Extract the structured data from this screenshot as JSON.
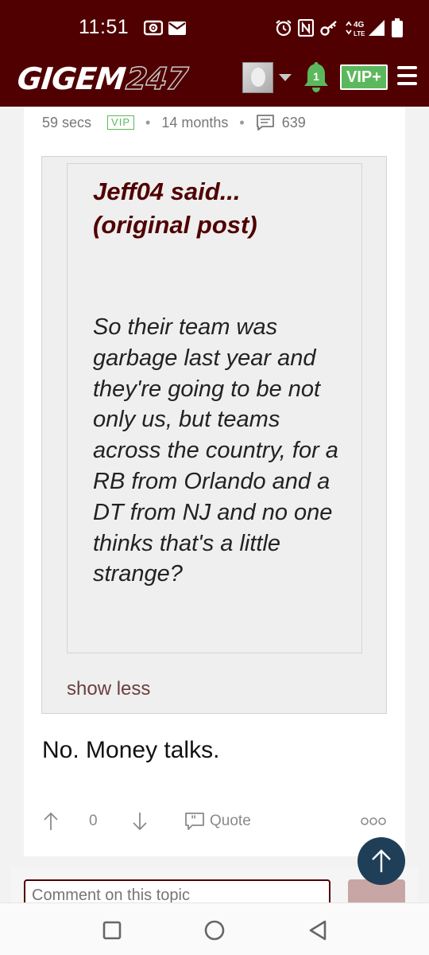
{
  "status_bar": {
    "time": "11:51",
    "network_label": "4G LTE"
  },
  "app_bar": {
    "logo_main": "GIGEM",
    "logo_number": "247",
    "notification_count": "1",
    "vip_button_label": "VIP+"
  },
  "post": {
    "meta": {
      "age": "59 secs",
      "badge": "VIP",
      "joined": "14 months",
      "reply_count": "639"
    },
    "quote": {
      "author_line": "Jeff04 said...",
      "original_link": "original post",
      "body": "So their team was garbage last year and they're going to be not only us, but teams across the country, for a RB from Orlando and a DT from NJ and no one thinks that's a little strange?",
      "toggle_label": "show less"
    },
    "reply": "No. Money talks.",
    "actions": {
      "vote_count": "0",
      "quote_label": "Quote"
    }
  },
  "comment": {
    "placeholder": "Comment on this topic"
  },
  "colors": {
    "brand_maroon": "#500000",
    "vip_green": "#5cb85c",
    "scroll_button": "#1f3f58"
  },
  "icons": [
    "mic-icon",
    "mail-icon",
    "alarm-icon",
    "nfc-icon",
    "key-icon",
    "signal-icon",
    "battery-icon",
    "bell-icon",
    "menu-icon",
    "comment-icon",
    "upvote-icon",
    "downvote-icon",
    "quote-icon",
    "more-icon",
    "arrow-up-icon",
    "square-nav-icon",
    "circle-nav-icon",
    "triangle-back-icon"
  ]
}
